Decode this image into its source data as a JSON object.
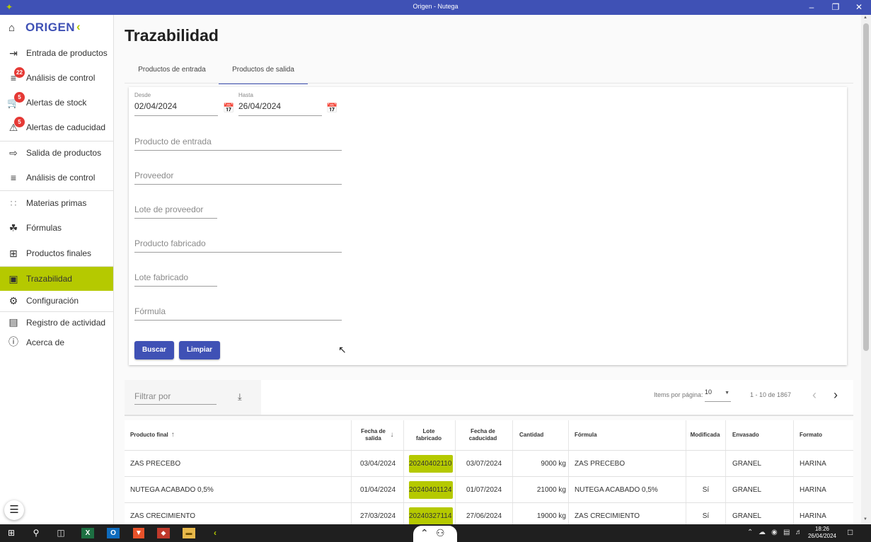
{
  "window": {
    "title": "Origen - Nutega"
  },
  "sidebar": {
    "brand": "ORIGEN",
    "items": [
      {
        "label": "Entrada de productos",
        "icon": "login-icon"
      },
      {
        "label": "Análisis de control",
        "icon": "checklist-icon",
        "badge": "22"
      },
      {
        "label": "Alertas de stock",
        "icon": "cart-icon",
        "badge": "5"
      },
      {
        "label": "Alertas de caducidad",
        "icon": "warning-icon",
        "badge": "5"
      },
      {
        "label": "Salida de productos",
        "icon": "logout-icon"
      },
      {
        "label": "Análisis de control",
        "icon": "checklist-icon"
      },
      {
        "label": "Materias primas",
        "icon": "grid-dots-icon"
      },
      {
        "label": "Fórmulas",
        "icon": "paint-bucket-icon"
      },
      {
        "label": "Productos finales",
        "icon": "table-grid-icon"
      },
      {
        "label": "Trazabilidad",
        "icon": "search-doc-icon",
        "active": true
      },
      {
        "label": "Configuración",
        "icon": "gear-icon"
      },
      {
        "label": "Registro de actividad",
        "icon": "list-box-icon"
      },
      {
        "label": "Acerca de",
        "icon": "info-icon"
      }
    ]
  },
  "page": {
    "title": "Trazabilidad",
    "tabs": [
      {
        "label": "Productos de entrada",
        "active": false
      },
      {
        "label": "Productos de salida",
        "active": true
      }
    ]
  },
  "form": {
    "desde": {
      "label": "Desde",
      "value": "02/04/2024"
    },
    "hasta": {
      "label": "Hasta",
      "value": "26/04/2024"
    },
    "producto_entrada": "Producto de entrada",
    "proveedor": "Proveedor",
    "lote_proveedor": "Lote de proveedor",
    "producto_fabricado": "Producto fabricado",
    "lote_fabricado": "Lote fabricado",
    "formula": "Fórmula",
    "buscar": "Buscar",
    "limpiar": "Limpiar"
  },
  "filter": {
    "placeholder": "Filtrar por",
    "items_per_page_label": "Items por página:",
    "items_per_page": "10",
    "range": "1 - 10 de 1867"
  },
  "table": {
    "headers": {
      "producto_final": "Producto final",
      "fecha_salida": "Fecha de salida",
      "lote_fabricado": "Lote fabricado",
      "fecha_caducidad": "Fecha de caducidad",
      "cantidad": "Cantidad",
      "formula": "Fórmula",
      "modificada": "Modificada",
      "envasado": "Envasado",
      "formato": "Formato"
    },
    "rows": [
      {
        "producto": "ZAS PRECEBO",
        "fecha_salida": "03/04/2024",
        "lote": "20240402110",
        "caducidad": "03/07/2024",
        "cantidad": "9000 kg",
        "formula": "ZAS PRECEBO",
        "modificada": "",
        "envasado": "GRANEL",
        "formato": "HARINA"
      },
      {
        "producto": "NUTEGA ACABADO 0,5%",
        "fecha_salida": "01/04/2024",
        "lote": "20240401124",
        "caducidad": "01/07/2024",
        "cantidad": "21000 kg",
        "formula": "NUTEGA ACABADO 0,5%",
        "modificada": "Sí",
        "envasado": "GRANEL",
        "formato": "HARINA"
      },
      {
        "producto": "ZAS CRECIMIENTO",
        "fecha_salida": "27/03/2024",
        "lote": "20240327114",
        "caducidad": "27/06/2024",
        "cantidad": "19000 kg",
        "formula": "ZAS CRECIMIENTO",
        "modificada": "Sí",
        "envasado": "GRANEL",
        "formato": "HARINA"
      }
    ]
  },
  "taskbar": {
    "time": "18:26",
    "date": "26/04/2024"
  },
  "colors": {
    "primary": "#3f51b5",
    "accent": "#b5c900",
    "badge": "#e53935"
  }
}
